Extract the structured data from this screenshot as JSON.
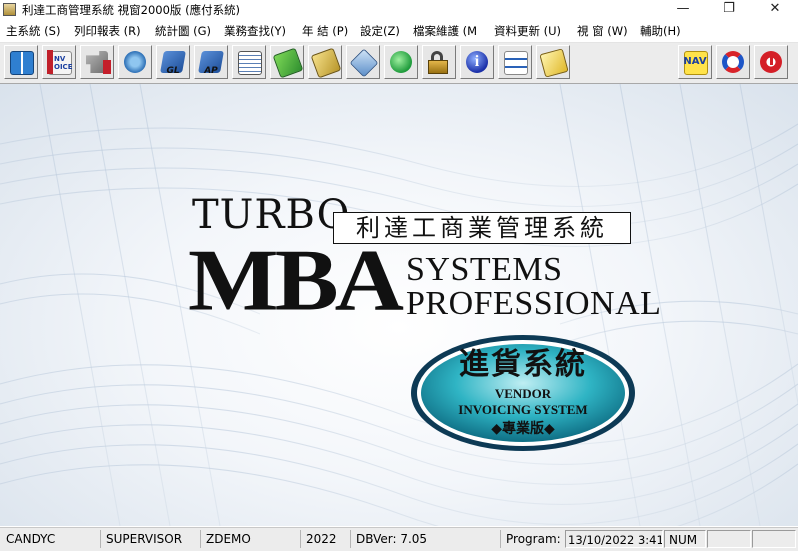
{
  "window": {
    "title": "利達工商管理系統 視窗2000版 (應付系統)",
    "minimize": "—",
    "restore": "❐",
    "close": "✕"
  },
  "menu": [
    "主系統 (S)",
    "列印報表 (R)",
    "統計圖 (G)",
    "業務查找(Y)",
    "年 結 (P)",
    "設定(Z)",
    "檔案維護 (M",
    "資料更新 (U)",
    "視 窗 (W)",
    "輔助(H)"
  ],
  "toolbar": {
    "invoice_label": "NV\nOICE",
    "gl_label": "GL",
    "ap_label": "AP",
    "nav_label": "NAV",
    "icons": [
      "book-icon",
      "invoice-icon",
      "tools-icon",
      "network-icon",
      "gl-ledger-icon",
      "ap-ledger-icon",
      "report-icon",
      "green-disk-icon",
      "gold-disk-icon",
      "disk-drive-icon",
      "globe-icon",
      "lock-icon",
      "info-icon",
      "numbered-list-icon",
      "notepad-icon",
      "nav-icon",
      "refresh-icon",
      "power-icon"
    ]
  },
  "splash": {
    "turbo": "TURBO",
    "mba": "MBA",
    "systems": "SYSTEMS",
    "professional": "PROFESSIONAL",
    "chinese_title": "利達工商業管理系統",
    "badge_chinese": "進貨系統",
    "badge_line1": "VENDOR",
    "badge_line2": "INVOICING SYSTEM",
    "badge_edition": "◆專業版◆"
  },
  "status": {
    "company": "CANDYC",
    "user": "SUPERVISOR",
    "database": "ZDEMO",
    "year": "2022",
    "dbver": "DBVer: 7.05",
    "program_label": "Program:",
    "datetime": "13/10/2022 3:41:",
    "numlock": "NUM"
  },
  "colors": {
    "toolbar_bg": "#ececec",
    "badge_teal": "#1aa6b8",
    "badge_border": "#0d3a55"
  }
}
